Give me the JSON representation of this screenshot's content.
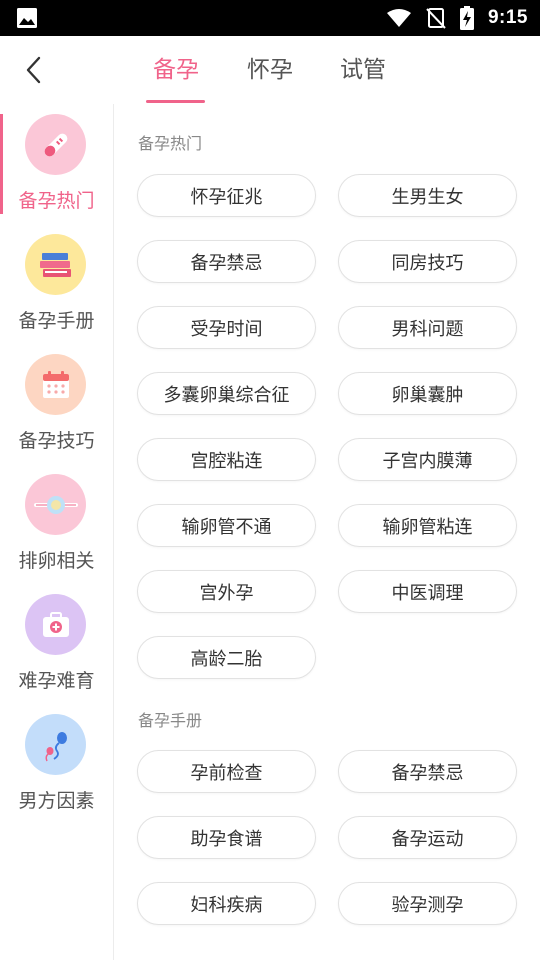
{
  "status_bar": {
    "time": "9:15",
    "icons": [
      "image-icon",
      "wifi-icon",
      "no-signal-icon",
      "battery-charging-icon"
    ]
  },
  "header": {
    "back_icon": "chevron-left-icon",
    "tabs": [
      {
        "label": "备孕",
        "active": true
      },
      {
        "label": "怀孕",
        "active": false
      },
      {
        "label": "试管",
        "active": false
      }
    ],
    "accent_color": "#f0638a"
  },
  "sidebar": {
    "items": [
      {
        "label": "备孕热门",
        "icon": "pregnancy-test-icon",
        "active": true
      },
      {
        "label": "备孕手册",
        "icon": "books-icon",
        "active": false
      },
      {
        "label": "备孕技巧",
        "icon": "calendar-icon",
        "active": false
      },
      {
        "label": "排卵相关",
        "icon": "ovulation-icon",
        "active": false
      },
      {
        "label": "难孕难育",
        "icon": "medical-kit-icon",
        "active": false
      },
      {
        "label": "男方因素",
        "icon": "sperm-icon",
        "active": false
      }
    ]
  },
  "sections": [
    {
      "title": "备孕热门",
      "items": [
        "怀孕征兆",
        "生男生女",
        "备孕禁忌",
        "同房技巧",
        "受孕时间",
        "男科问题",
        "多囊卵巢综合征",
        "卵巢囊肿",
        "宫腔粘连",
        "子宫内膜薄",
        "输卵管不通",
        "输卵管粘连",
        "宫外孕",
        "中医调理",
        "高龄二胎"
      ]
    },
    {
      "title": "备孕手册",
      "items": [
        "孕前检查",
        "备孕禁忌",
        "助孕食谱",
        "备孕运动",
        "妇科疾病",
        "验孕测孕"
      ]
    }
  ]
}
